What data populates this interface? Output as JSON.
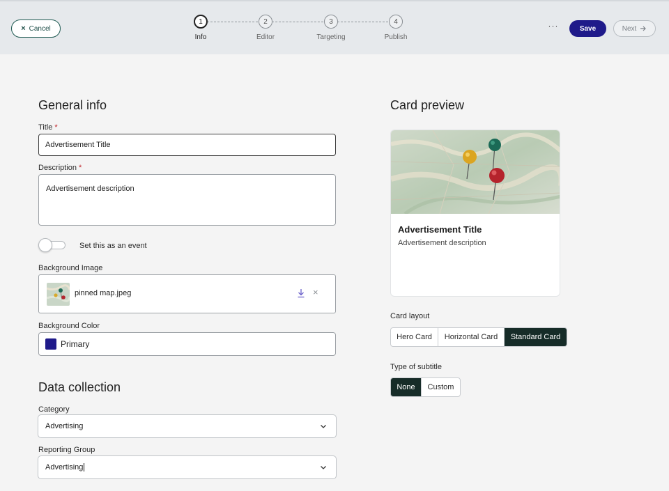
{
  "header": {
    "cancel_label": "Cancel",
    "steps": [
      {
        "number": "1",
        "label": "Info"
      },
      {
        "number": "2",
        "label": "Editor"
      },
      {
        "number": "3",
        "label": "Targeting"
      },
      {
        "number": "4",
        "label": "Publish"
      }
    ],
    "active_step": 1,
    "more_label": "···",
    "save_label": "Save",
    "next_label": "Next"
  },
  "general_info": {
    "heading": "General info",
    "title_label": "Title",
    "title_value": "Advertisement Title",
    "description_label": "Description",
    "description_value": "Advertisement description",
    "required_mark": "*",
    "event_toggle_label": "Set this as an event",
    "event_toggle_on": false,
    "background_image_label": "Background Image",
    "background_image_file": "pinned map.jpeg",
    "background_color_label": "Background Color",
    "background_color_value": "Primary",
    "background_color_hex": "#1f1a8a"
  },
  "data_collection": {
    "heading": "Data collection",
    "category_label": "Category",
    "category_value": "Advertising",
    "reporting_group_label": "Reporting Group",
    "reporting_group_value": "Advertising"
  },
  "preview": {
    "heading": "Card preview",
    "card_title": "Advertisement Title",
    "card_description": "Advertisement description",
    "card_layout_label": "Card layout",
    "card_layout_options": [
      "Hero Card",
      "Horizontal Card",
      "Standard Card"
    ],
    "card_layout_selected": "Standard Card",
    "subtitle_type_label": "Type of subtitle",
    "subtitle_type_options": [
      "None",
      "Custom"
    ],
    "subtitle_type_selected": "None"
  },
  "colors": {
    "primary": "#1f1a8a",
    "selected_segment": "#162c28",
    "cancel_border": "#1f5a52",
    "required": "#c0272d"
  }
}
